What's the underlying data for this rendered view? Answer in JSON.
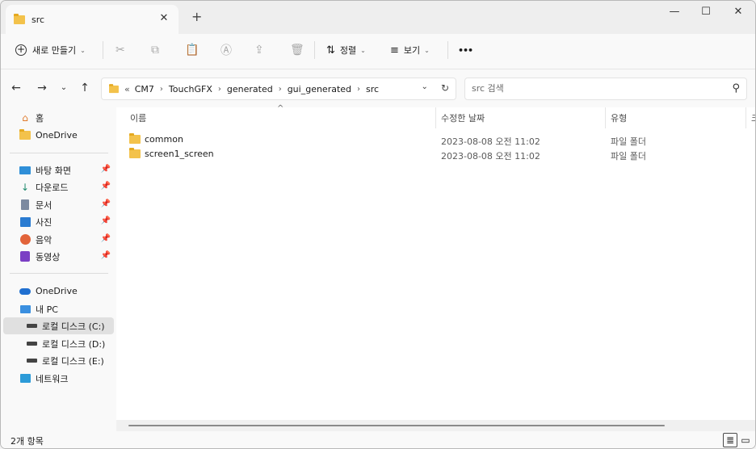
{
  "tab": {
    "title": "src",
    "close": "✕",
    "new": "+"
  },
  "window_controls": {
    "minimize": "—",
    "maximize": "☐",
    "close": "✕"
  },
  "commandbar": {
    "new_label": "새로 만들기",
    "sort_label": "정렬",
    "view_label": "보기",
    "more_label": "•••"
  },
  "address": {
    "overflow": "«",
    "crumbs": [
      "CM7",
      "TouchGFX",
      "generated",
      "gui_generated",
      "src"
    ]
  },
  "search": {
    "placeholder": "src 검색"
  },
  "sidebar": {
    "home": "홈",
    "onedrive_top": "OneDrive",
    "desktop": "바탕 화면",
    "downloads": "다운로드",
    "documents": "문서",
    "pictures": "사진",
    "music": "음악",
    "videos": "동영상",
    "onedrive": "OneDrive",
    "mypc": "내 PC",
    "drive_c": "로컬 디스크 (C:)",
    "drive_d": "로컬 디스크 (D:)",
    "drive_e": "로컬 디스크 (E:)",
    "network": "네트워크"
  },
  "columns": {
    "name": "이름",
    "date": "수정한 날짜",
    "type": "유형",
    "size": "크"
  },
  "files": [
    {
      "name": "common",
      "date": "2023-08-08 오전 11:02",
      "type": "파일 폴더"
    },
    {
      "name": "screen1_screen",
      "date": "2023-08-08 오전 11:02",
      "type": "파일 폴더"
    }
  ],
  "status": {
    "count": "2개 항목"
  },
  "colors": {
    "folder": "#f3c24b",
    "selected_bg": "#e0e0e0",
    "accent": "#0067c0"
  }
}
